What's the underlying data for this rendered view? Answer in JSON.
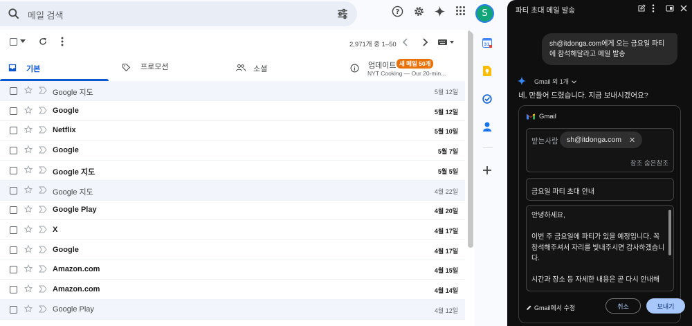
{
  "search": {
    "placeholder": "메일 검색"
  },
  "user": {
    "initial": "S",
    "avatar_color": "#12a578"
  },
  "toolbar": {
    "count_text": "2,971개 중 1–50"
  },
  "tabs": [
    {
      "label": "기본",
      "icon": "inbox-icon",
      "active": true
    },
    {
      "label": "프로모션",
      "icon": "tag-icon",
      "active": false
    },
    {
      "label": "소셜",
      "icon": "people-icon",
      "active": false
    },
    {
      "label": "업데이트",
      "icon": "info-icon",
      "active": false,
      "badge": "새 메일 50개",
      "subtitle": "NYT Cooking — Our 20-min..."
    }
  ],
  "emails": [
    {
      "sender": "Google 지도",
      "date": "5월 12일",
      "unread": false
    },
    {
      "sender": "Google",
      "date": "5월 12일",
      "unread": true
    },
    {
      "sender": "Netflix",
      "date": "5월 10일",
      "unread": true
    },
    {
      "sender": "Google",
      "date": "5월 7일",
      "unread": true
    },
    {
      "sender": "Google 지도",
      "date": "5월 5일",
      "unread": true
    },
    {
      "sender": "Google 지도",
      "date": "4월 22일",
      "unread": false
    },
    {
      "sender": "Google Play",
      "date": "4월 20일",
      "unread": true
    },
    {
      "sender": "X",
      "date": "4월 17일",
      "unread": true
    },
    {
      "sender": "Google",
      "date": "4월 17일",
      "unread": true
    },
    {
      "sender": "Amazon.com",
      "date": "4월 15일",
      "unread": true
    },
    {
      "sender": "Amazon.com",
      "date": "4월 14일",
      "unread": true
    },
    {
      "sender": "Google Play",
      "date": "4월 12일",
      "unread": false
    }
  ],
  "gemini": {
    "title": "파티 초대 메일 발송",
    "user_prompt": "sh@itdonga.com에게 오는 금요일 파티에 참석해달라고 메일 발송",
    "source_label": "Gmail 외 1개",
    "reply": "네, 만들어 드렸습니다. 지금 보내시겠어요?",
    "card": {
      "app_label": "Gmail",
      "to_label": "받는사람",
      "recipient": "sh@itdonga.com",
      "cc_bcc": "참조 숨은참조",
      "subject": "금요일 파티 초대 안내",
      "body": "안녕하세요,\n\n이번 주 금요일에 파티가 있을 예정입니다. 꼭 참석해주셔서 자리를 빛내주시면 감사하겠습니다.\n\n시간과 장소 등 자세한 내용은 곧 다시 안내해",
      "edit_label": "Gmail에서 수정",
      "cancel_label": "취소",
      "send_label": "보내기"
    }
  }
}
